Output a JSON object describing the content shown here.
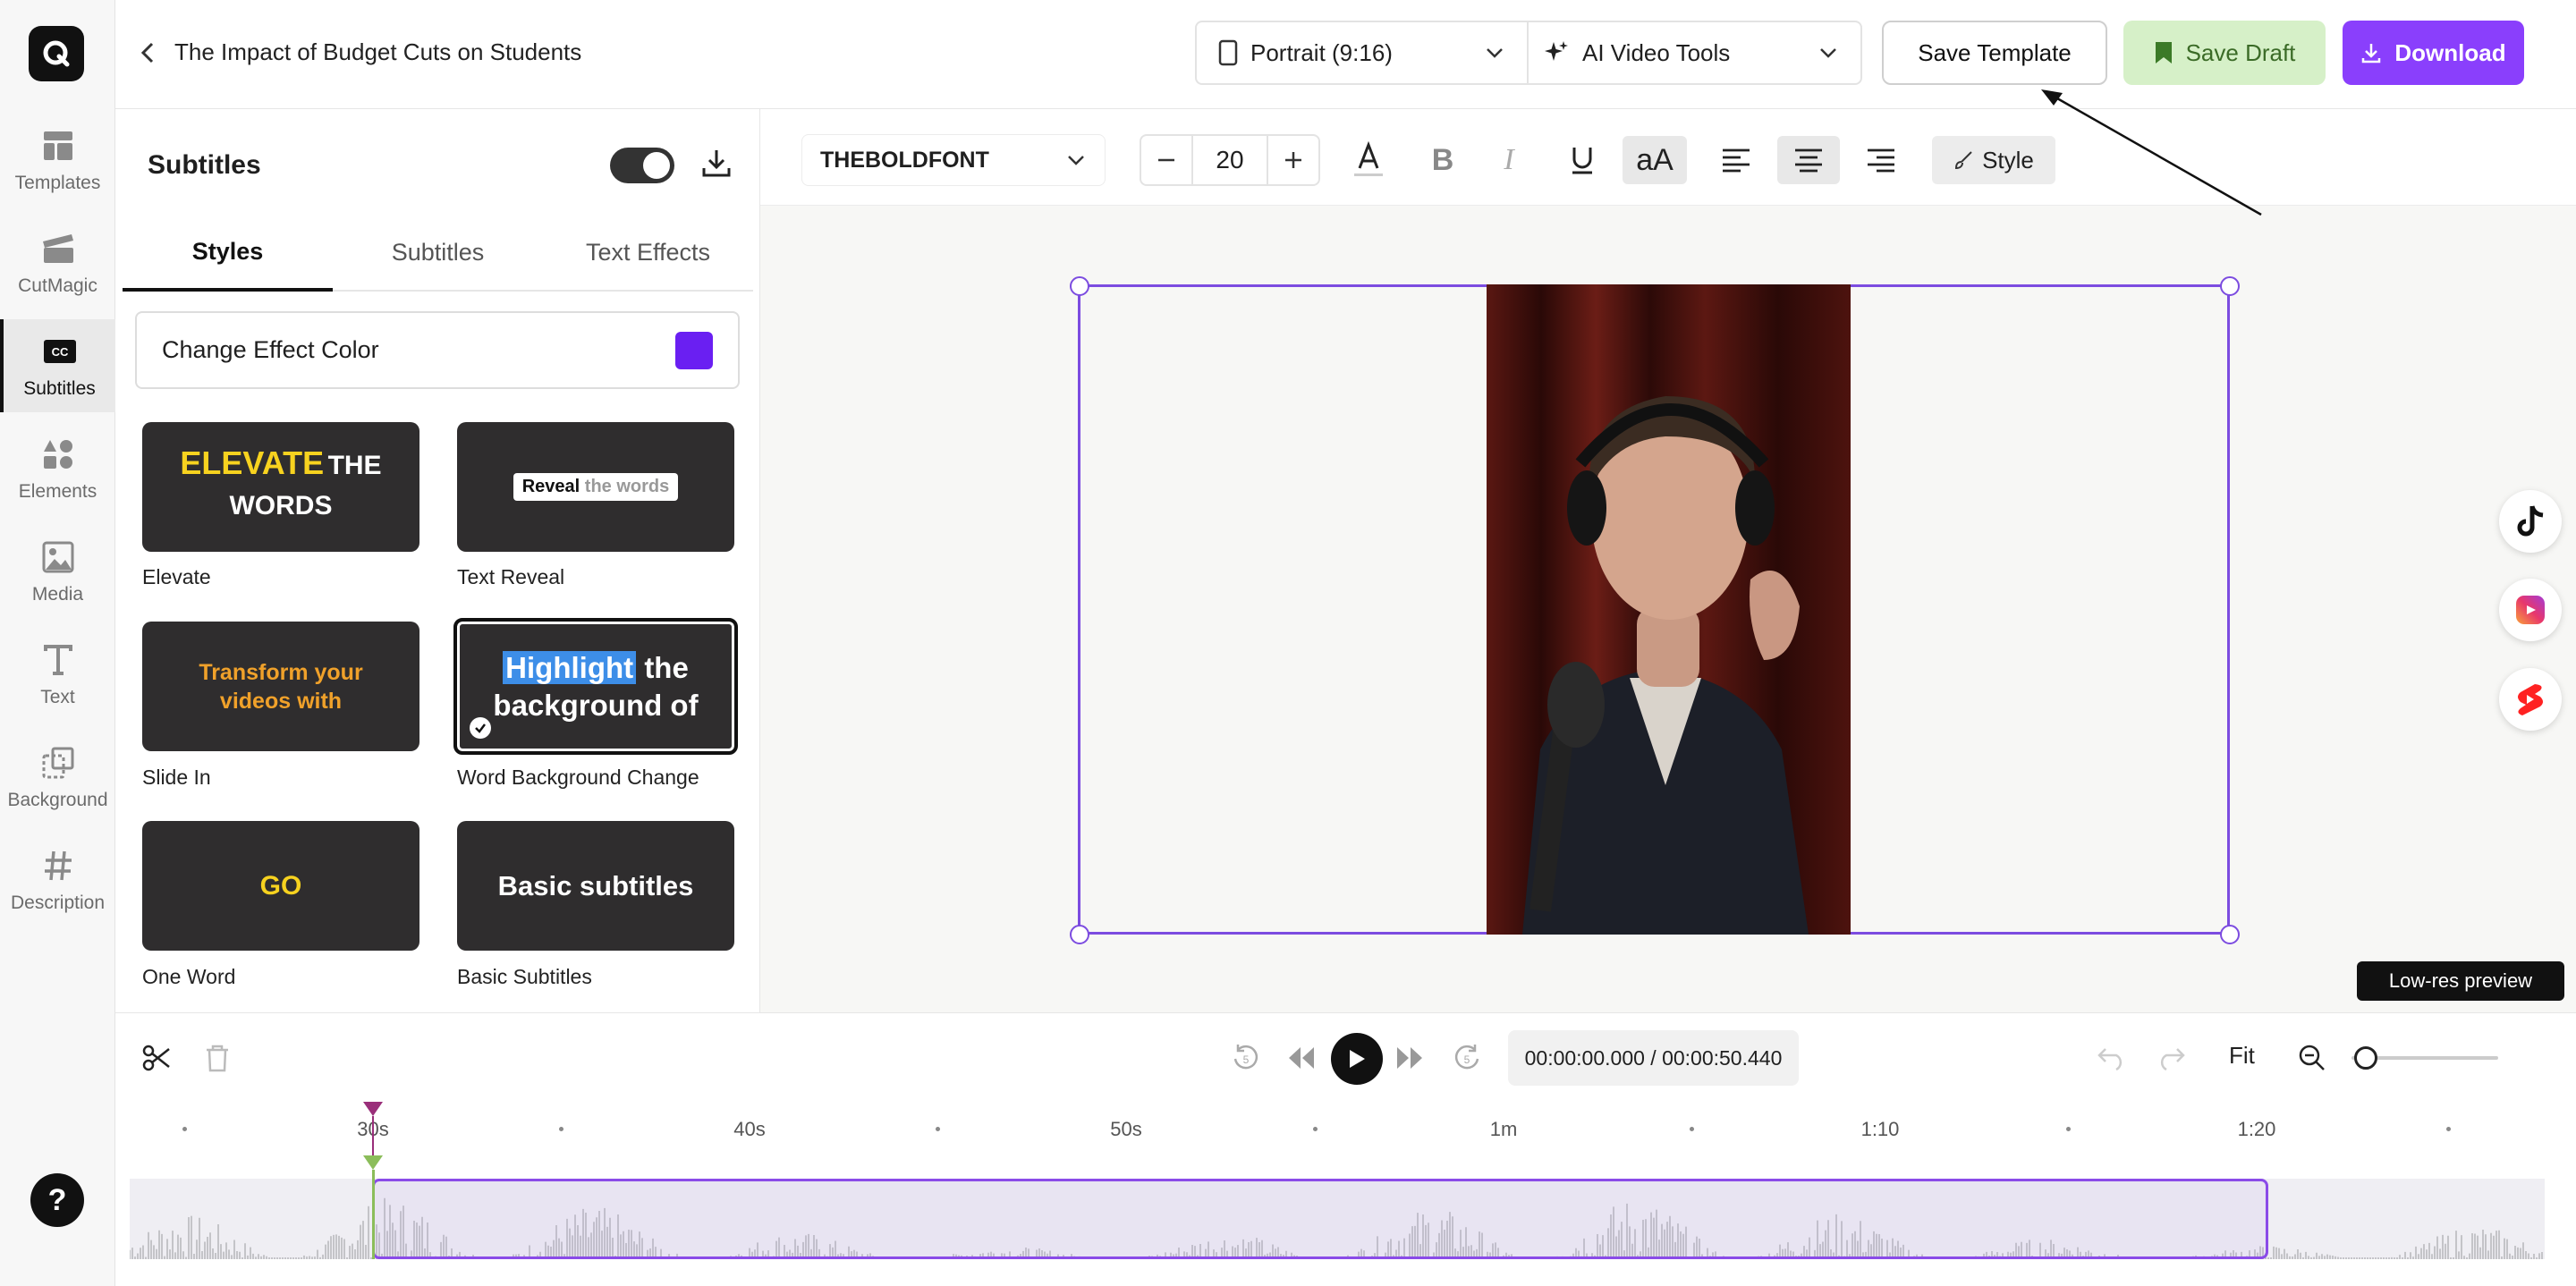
{
  "app": {
    "project_title": "The Impact of Budget Cuts on Students",
    "brand_color": "#8a3ffc"
  },
  "rail": {
    "items": [
      {
        "label": "Templates",
        "icon": "templates-icon"
      },
      {
        "label": "CutMagic",
        "icon": "clapperboard-icon"
      },
      {
        "label": "Subtitles",
        "icon": "cc-icon",
        "active": true
      },
      {
        "label": "Elements",
        "icon": "shapes-icon"
      },
      {
        "label": "Media",
        "icon": "image-icon"
      },
      {
        "label": "Text",
        "icon": "text-icon"
      },
      {
        "label": "Background",
        "icon": "background-icon"
      },
      {
        "label": "Description",
        "icon": "hashtag-icon"
      }
    ],
    "help": "?"
  },
  "topbar": {
    "aspect": "Portrait (9:16)",
    "tools": "AI Video Tools",
    "save_template": "Save Template",
    "save_draft": "Save Draft",
    "download": "Download"
  },
  "panel": {
    "title": "Subtitles",
    "subtitles_enabled": true,
    "tabs": [
      "Styles",
      "Subtitles",
      "Text Effects"
    ],
    "active_tab": "Styles",
    "effect_color_label": "Change Effect Color",
    "effect_color": "#6a1ff2",
    "styles": [
      {
        "name": "Elevate",
        "preview_a": "ELEVATE",
        "preview_b": "THE",
        "preview_c": "WORDS"
      },
      {
        "name": "Text Reveal",
        "preview_a": "Reveal",
        "preview_b": "the words"
      },
      {
        "name": "Slide In",
        "preview_a": "Transform your",
        "preview_b": "videos with"
      },
      {
        "name": "Word Background Change",
        "preview_a": "Highlight",
        "preview_b": "the",
        "preview_c": "background of",
        "selected": true
      },
      {
        "name": "One Word",
        "preview_a": "GO"
      },
      {
        "name": "Basic Subtitles",
        "preview_a": "Basic subtitles"
      }
    ]
  },
  "toolbar": {
    "font": "THEBOLDFONT",
    "size": "20",
    "case_button": "aA",
    "style_button": "Style"
  },
  "canvas": {
    "lowres_label": "Low-res preview",
    "socials": [
      "tiktok-icon",
      "instagram-reels-icon",
      "youtube-shorts-icon"
    ]
  },
  "playback": {
    "timecode": "00:00:00.000 / 00:00:50.440",
    "fit": "Fit",
    "zoom_level": 0.1
  },
  "timeline": {
    "ticks": [
      "30s",
      "40s",
      "50s",
      "1m",
      "1:10",
      "1:20"
    ]
  }
}
